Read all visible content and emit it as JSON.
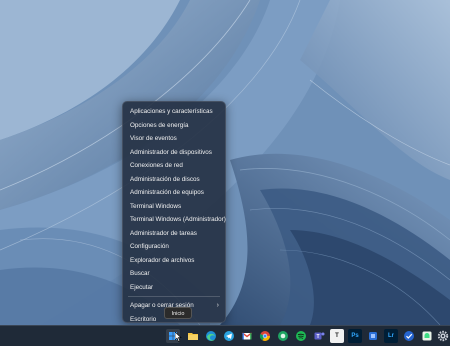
{
  "context_menu": {
    "items": [
      {
        "label": "Aplicaciones y características"
      },
      {
        "label": "Opciones de energía"
      },
      {
        "label": "Visor de eventos"
      },
      {
        "label": "Administrador de dispositivos"
      },
      {
        "label": "Conexiones de red"
      },
      {
        "label": "Administración de discos"
      },
      {
        "label": "Administración de equipos"
      },
      {
        "label": "Terminal Windows"
      },
      {
        "label": "Terminal Windows (Administrador)"
      },
      {
        "label": "Administrador de tareas"
      },
      {
        "label": "Configuración"
      },
      {
        "label": "Explorador de archivos"
      },
      {
        "label": "Buscar"
      },
      {
        "label": "Ejecutar"
      },
      {
        "label": "Apagar o cerrar sesión",
        "chevron": "›"
      },
      {
        "label": "Escritorio"
      }
    ]
  },
  "tooltip": {
    "text": "Inicio"
  },
  "taskbar": {
    "icons": [
      {
        "name": "start-button",
        "icon": "windows-logo-icon",
        "active": true
      },
      {
        "name": "file-explorer",
        "icon": "folder-icon"
      },
      {
        "name": "edge",
        "icon": "edge-browser-icon"
      },
      {
        "name": "telegram",
        "icon": "telegram-icon"
      },
      {
        "name": "gmail",
        "icon": "gmail-icon"
      },
      {
        "name": "chrome",
        "icon": "chrome-icon"
      },
      {
        "name": "green-app",
        "icon": "green-circle-icon"
      },
      {
        "name": "spotify",
        "icon": "spotify-icon"
      },
      {
        "name": "teams",
        "icon": "teams-icon"
      },
      {
        "name": "typora",
        "icon": "t-letter-icon",
        "text": "T"
      },
      {
        "name": "photoshop",
        "icon": "photoshop-icon",
        "text": "Ps"
      },
      {
        "name": "app-blue",
        "icon": "blue-square-icon"
      },
      {
        "name": "lightroom",
        "icon": "lightroom-icon",
        "text": "Lr"
      },
      {
        "name": "ms-todo",
        "icon": "check-icon"
      },
      {
        "name": "app-dark",
        "icon": "dark-square-icon"
      },
      {
        "name": "android-app",
        "icon": "android-icon"
      },
      {
        "name": "obs",
        "icon": "obs-icon"
      },
      {
        "name": "settings",
        "icon": "gear-icon"
      }
    ]
  }
}
